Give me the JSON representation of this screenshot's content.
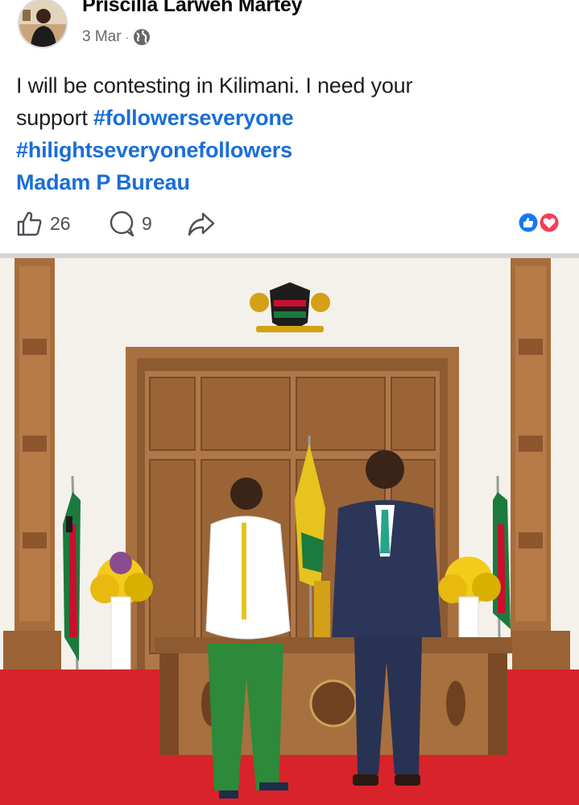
{
  "post": {
    "author": "Priscilla Larweh Martey",
    "date": "3 Mar",
    "separator": "·",
    "privacy_icon": "globe-icon",
    "text_line1": "I will be contesting in Kilimani. I need your",
    "text_word": "support",
    "hashtag1": "#followerseveryone",
    "hashtag2": "#hilightseveryonefollowers",
    "mention": "Madam P Bureau"
  },
  "actions": {
    "like_count": "26",
    "comment_count": "9",
    "like_icon": "thumbs-up-icon",
    "comment_icon": "comment-icon",
    "share_icon": "share-icon",
    "reaction_icons": [
      "like-reaction-icon",
      "love-reaction-icon"
    ]
  },
  "colors": {
    "link_blue": "#1a6ed8",
    "like_blue": "#1877f2",
    "love_red": "#f33e58",
    "carpet_red": "#d8232a",
    "wood": "#a86d3e"
  }
}
